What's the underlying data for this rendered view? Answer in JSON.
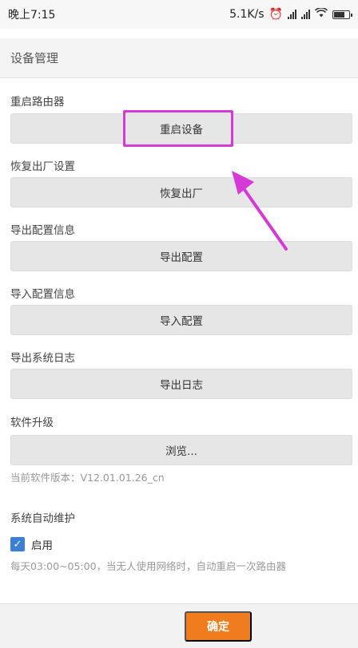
{
  "status_bar": {
    "time": "晚上7:15",
    "speed": "5.1K/s"
  },
  "header": {
    "title": "设备管理"
  },
  "sections": [
    {
      "label": "重启路由器",
      "button": "重启设备"
    },
    {
      "label": "恢复出厂设置",
      "button": "恢复出厂"
    },
    {
      "label": "导出配置信息",
      "button": "导出配置"
    },
    {
      "label": "导入配置信息",
      "button": "导入配置"
    },
    {
      "label": "导出系统日志",
      "button": "导出日志"
    },
    {
      "label": "软件升级",
      "button": "浏览..."
    }
  ],
  "firmware": {
    "version_text": "当前软件版本：V12.01.01.26_cn"
  },
  "auto_maintenance": {
    "label": "系统自动维护",
    "checkbox_label": "启用",
    "checked": true,
    "note": "每天03:00~05:00，当无人使用网络时，自动重启一次路由器"
  },
  "footer": {
    "confirm_label": "确定"
  },
  "colors": {
    "accent": "#f07c1e",
    "highlight": "#d63ad6",
    "checkbox": "#3b7fd9"
  }
}
